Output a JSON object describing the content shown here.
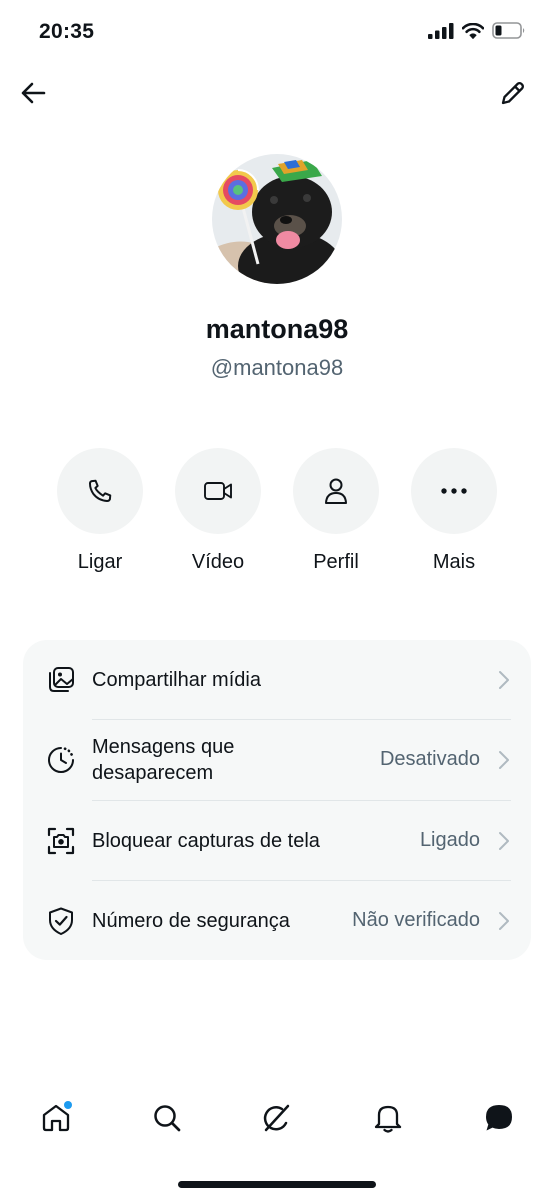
{
  "status": {
    "time": "20:35",
    "icons": [
      "cellular-signal-icon",
      "wifi-icon",
      "battery-icon"
    ]
  },
  "header": {
    "back_icon": "arrow-left-icon",
    "edit_icon": "pencil-icon"
  },
  "profile": {
    "display_name": "mantona98",
    "handle": "@mantona98"
  },
  "actions": [
    {
      "label": "Ligar",
      "icon": "phone-icon"
    },
    {
      "label": "Vídeo",
      "icon": "video-camera-icon"
    },
    {
      "label": "Perfil",
      "icon": "person-icon"
    },
    {
      "label": "Mais",
      "icon": "more-horizontal-icon"
    }
  ],
  "settings": [
    {
      "label_line1": "Compartilhar mídia",
      "label_line2": "",
      "value": "",
      "icon": "media-gallery-icon"
    },
    {
      "label_line1": "Mensagens que",
      "label_line2": "desaparecem",
      "value": "Desativado",
      "icon": "timer-icon"
    },
    {
      "label_line1": "Bloquear capturas de tela",
      "label_line2": "",
      "value": "Ligado",
      "icon": "screenshot-camera-icon"
    },
    {
      "label_line1": "Número de segurança",
      "label_line2": "",
      "value": "Não verificado",
      "icon": "shield-check-icon"
    }
  ],
  "tabs": [
    {
      "name": "home",
      "icon": "home-icon",
      "has_notification_dot": true
    },
    {
      "name": "search",
      "icon": "search-icon",
      "has_notification_dot": false
    },
    {
      "name": "grok",
      "icon": "grok-icon",
      "has_notification_dot": false
    },
    {
      "name": "notifications",
      "icon": "bell-icon",
      "has_notification_dot": false
    },
    {
      "name": "messages",
      "icon": "chat-bubble-icon",
      "has_notification_dot": false
    }
  ],
  "colors": {
    "text_primary": "#0f1419",
    "text_secondary": "#536471",
    "card_bg": "#f6f8f8",
    "button_bg": "#f2f4f4",
    "accent": "#1d9bf0"
  }
}
